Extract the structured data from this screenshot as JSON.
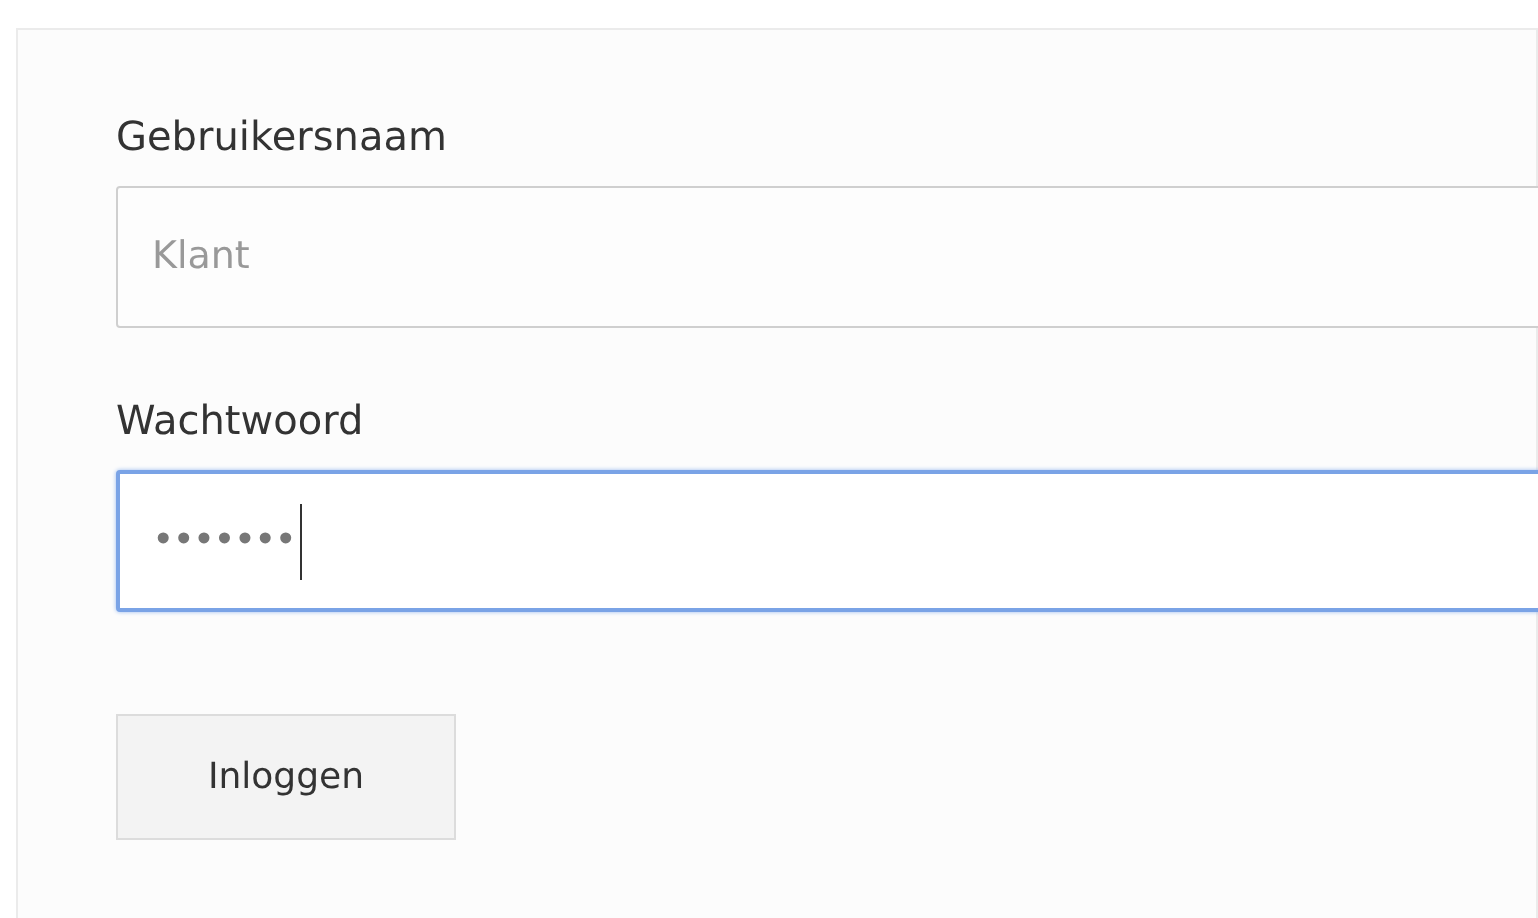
{
  "fields": [
    {
      "label": "Gebruikersnaam",
      "placeholder": "Klant",
      "focused": false
    },
    {
      "label": "Wachtwoord",
      "value": "•••••••",
      "focused": true
    }
  ],
  "buttons": [
    "Inloggen"
  ]
}
